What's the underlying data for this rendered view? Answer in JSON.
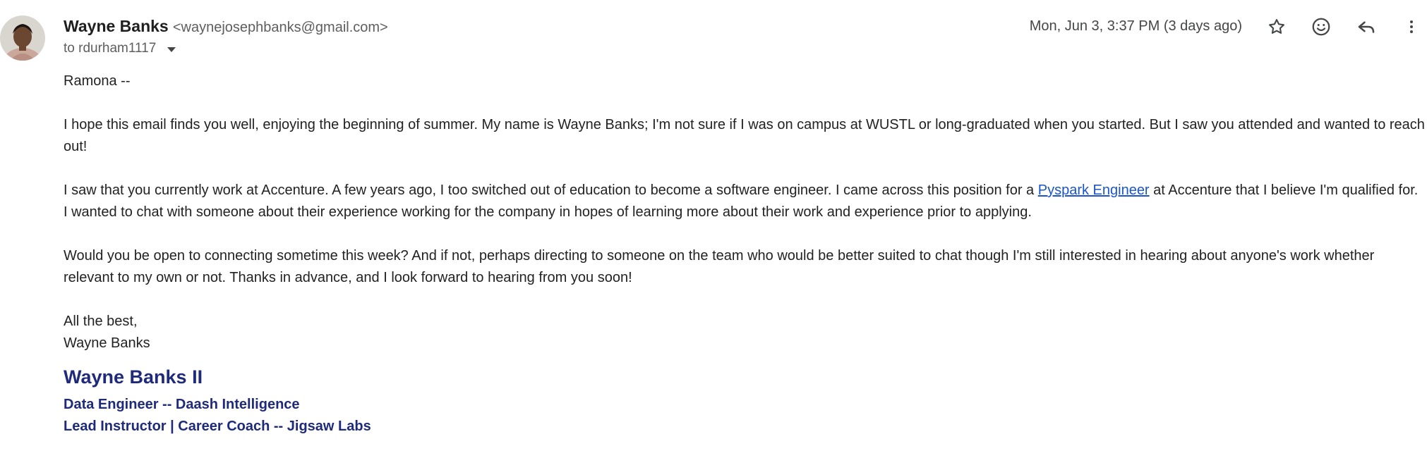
{
  "sender": {
    "name": "Wayne Banks",
    "email": "<waynejosephbanks@gmail.com>"
  },
  "recipient": {
    "to_label": "to rdurham1117"
  },
  "date": "Mon, Jun 3, 3:37 PM (3 days ago)",
  "icons": [
    "star-icon",
    "emoji-icon",
    "reply-icon",
    "more-vert-icon"
  ],
  "body": {
    "greeting": "Ramona --",
    "para1": "I hope this email finds you well, enjoying the beginning of summer. My name is Wayne Banks; I'm not sure if I was on campus at WUSTL or long-graduated when you started. But I saw you attended and wanted to reach out!",
    "para2_before": "I saw that you currently work at Accenture. A few years ago, I too switched out of education to become a software engineer. I came across this position for a ",
    "para2_link": "Pyspark Engineer",
    "para2_after": " at Accenture that I believe I'm qualified for. I wanted to chat with someone about their experience working for the company in hopes of learning more about their work and experience prior to applying.",
    "para3": "Would you be open to connecting sometime this week? And if not, perhaps directing to someone on the team who would be better suited to chat though I'm still interested in hearing about anyone's work whether relevant to my own or not. Thanks in advance, and I look forward to hearing from you soon!",
    "closing": "All the best,",
    "closing_name": "Wayne Banks"
  },
  "signature": {
    "name": "Wayne Banks II",
    "line1": "Data Engineer -- Daash Intelligence",
    "line2": "Lead Instructor | Career Coach -- Jigsaw Labs"
  },
  "colors": {
    "link": "#1a55cc",
    "signature": "#1f2b7a"
  }
}
